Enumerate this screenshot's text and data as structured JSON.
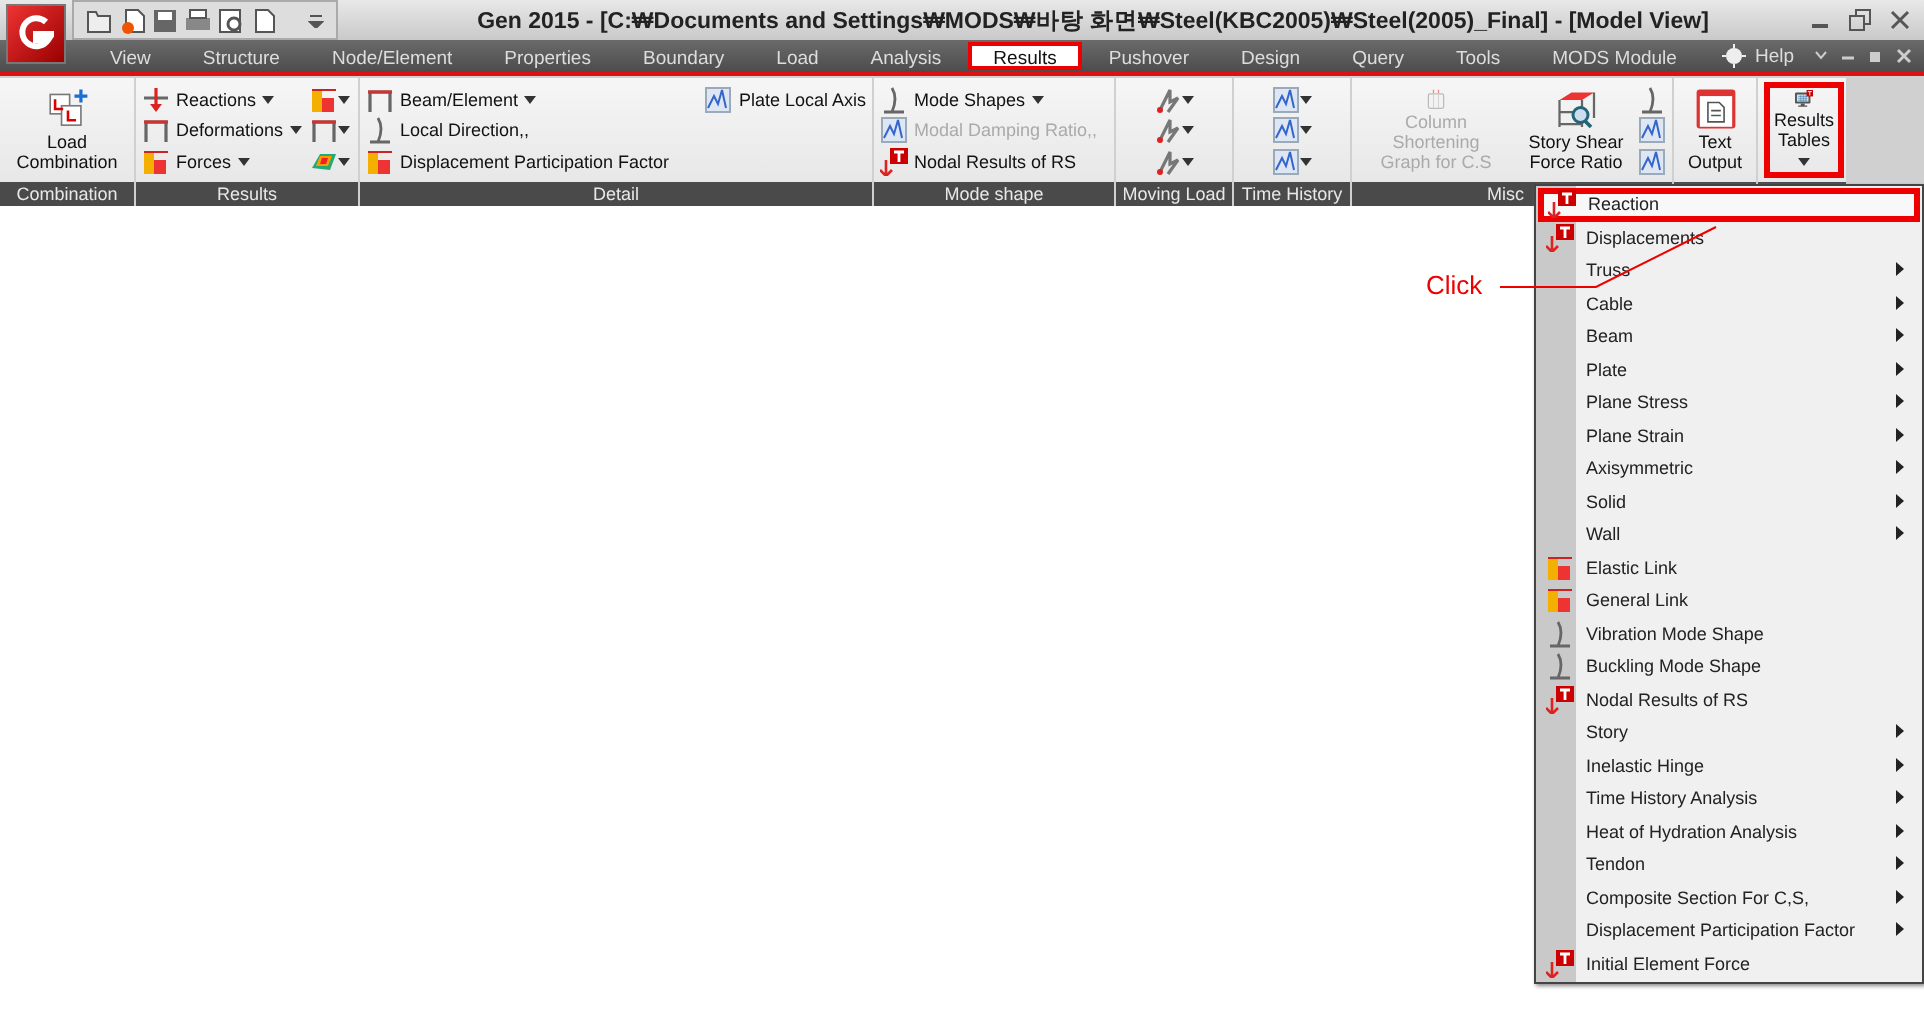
{
  "title_bar": {
    "title": "Gen 2015 - [C:₩Documents and Settings₩MODS₩바탕 화면₩Steel(KBC2005)₩Steel(2005)_Final] - [Model View]"
  },
  "menu_tabs": [
    {
      "label": "View",
      "selected": false,
      "highlighted": false
    },
    {
      "label": "Structure",
      "selected": false,
      "highlighted": false
    },
    {
      "label": "Node/Element",
      "selected": false,
      "highlighted": false
    },
    {
      "label": "Properties",
      "selected": false,
      "highlighted": false
    },
    {
      "label": "Boundary",
      "selected": false,
      "highlighted": false
    },
    {
      "label": "Load",
      "selected": false,
      "highlighted": false
    },
    {
      "label": "Analysis",
      "selected": false,
      "highlighted": false
    },
    {
      "label": "Results",
      "selected": true,
      "highlighted": true
    },
    {
      "label": "Pushover",
      "selected": false,
      "highlighted": false
    },
    {
      "label": "Design",
      "selected": false,
      "highlighted": false
    },
    {
      "label": "Query",
      "selected": false,
      "highlighted": false
    },
    {
      "label": "Tools",
      "selected": false,
      "highlighted": false
    },
    {
      "label": "MODS Module",
      "selected": false,
      "highlighted": false
    }
  ],
  "help": {
    "label": "Help"
  },
  "ribbon_groups": [
    {
      "label": "Combination",
      "items": [
        {
          "kind": "large",
          "label": "Load Combination",
          "disabled": false,
          "highlighted": false,
          "dropdown": false
        }
      ]
    },
    {
      "label": "Results",
      "items": [
        {
          "kind": "small",
          "label": "Reactions",
          "disabled": false,
          "dropdown": true
        },
        {
          "kind": "small",
          "label": "Deformations",
          "disabled": false,
          "dropdown": true
        },
        {
          "kind": "small",
          "label": "Forces",
          "disabled": false,
          "dropdown": true
        },
        {
          "kind": "iconcol"
        }
      ]
    },
    {
      "label": "Detail",
      "items": [
        {
          "kind": "small",
          "label": "Beam/Element",
          "disabled": false,
          "dropdown": true
        },
        {
          "kind": "small",
          "label": "Local Direction,,",
          "disabled": false,
          "dropdown": false
        },
        {
          "kind": "small",
          "label": "Displacement Participation Factor",
          "disabled": false,
          "dropdown": false
        },
        {
          "kind": "smalltop",
          "label": "Plate Local Axis",
          "disabled": false,
          "dropdown": false
        }
      ]
    },
    {
      "label": "Mode shape",
      "items": [
        {
          "kind": "small",
          "label": "Mode Shapes",
          "disabled": false,
          "dropdown": true
        },
        {
          "kind": "small",
          "label": "Modal Damping Ratio,,",
          "disabled": true,
          "dropdown": false
        },
        {
          "kind": "small",
          "label": "Nodal Results of RS",
          "disabled": false,
          "dropdown": false
        }
      ]
    },
    {
      "label": "Moving Load",
      "items": [
        {
          "kind": "iconcol"
        }
      ]
    },
    {
      "label": "Time History",
      "items": [
        {
          "kind": "iconcol"
        }
      ]
    },
    {
      "label": "Misc",
      "items": [
        {
          "kind": "large",
          "label": "Column Shortening Graph for C.S",
          "disabled": true,
          "highlighted": false,
          "dropdown": false
        },
        {
          "kind": "large",
          "label": "Story Shear Force Ratio",
          "disabled": false,
          "highlighted": false,
          "dropdown": false
        },
        {
          "kind": "iconcol"
        }
      ]
    },
    {
      "items": [
        {
          "kind": "large",
          "label": "Text Output",
          "disabled": false,
          "highlighted": false,
          "dropdown": false
        }
      ]
    },
    {
      "items": [
        {
          "kind": "large",
          "label": "Results Tables",
          "disabled": false,
          "highlighted": true,
          "dropdown": true
        }
      ]
    }
  ],
  "results_tables_menu": [
    {
      "label": "Reaction",
      "has_icon": true,
      "has_submenu": false,
      "highlighted": true
    },
    {
      "label": "Displacements",
      "has_icon": true,
      "has_submenu": false,
      "highlighted": false
    },
    {
      "label": "Truss",
      "has_icon": false,
      "has_submenu": true,
      "highlighted": false
    },
    {
      "label": "Cable",
      "has_icon": false,
      "has_submenu": true,
      "highlighted": false
    },
    {
      "label": "Beam",
      "has_icon": false,
      "has_submenu": true,
      "highlighted": false
    },
    {
      "label": "Plate",
      "has_icon": false,
      "has_submenu": true,
      "highlighted": false
    },
    {
      "label": "Plane Stress",
      "has_icon": false,
      "has_submenu": true,
      "highlighted": false
    },
    {
      "label": "Plane Strain",
      "has_icon": false,
      "has_submenu": true,
      "highlighted": false
    },
    {
      "label": "Axisymmetric",
      "has_icon": false,
      "has_submenu": true,
      "highlighted": false
    },
    {
      "label": "Solid",
      "has_icon": false,
      "has_submenu": true,
      "highlighted": false
    },
    {
      "label": "Wall",
      "has_icon": false,
      "has_submenu": true,
      "highlighted": false
    },
    {
      "label": "Elastic Link",
      "has_icon": true,
      "has_submenu": false,
      "highlighted": false
    },
    {
      "label": "General Link",
      "has_icon": true,
      "has_submenu": false,
      "highlighted": false
    },
    {
      "label": "Vibration Mode Shape",
      "has_icon": true,
      "has_submenu": false,
      "highlighted": false
    },
    {
      "label": "Buckling Mode Shape",
      "has_icon": true,
      "has_submenu": false,
      "highlighted": false
    },
    {
      "label": "Nodal Results of RS",
      "has_icon": true,
      "has_submenu": false,
      "highlighted": false
    },
    {
      "label": "Story",
      "has_icon": false,
      "has_submenu": true,
      "highlighted": false
    },
    {
      "label": "Inelastic Hinge",
      "has_icon": false,
      "has_submenu": true,
      "highlighted": false
    },
    {
      "label": "Time History Analysis",
      "has_icon": false,
      "has_submenu": true,
      "highlighted": false
    },
    {
      "label": "Heat of Hydration Analysis",
      "has_icon": false,
      "has_submenu": true,
      "highlighted": false
    },
    {
      "label": "Tendon",
      "has_icon": false,
      "has_submenu": true,
      "highlighted": false
    },
    {
      "label": "Composite Section For C,S,",
      "has_icon": false,
      "has_submenu": true,
      "highlighted": false
    },
    {
      "label": "Displacement Participation Factor",
      "has_icon": false,
      "has_submenu": true,
      "highlighted": false
    },
    {
      "label": "Initial Element Force",
      "has_icon": true,
      "has_submenu": false,
      "highlighted": false
    }
  ],
  "annotation": {
    "text": "Click"
  }
}
